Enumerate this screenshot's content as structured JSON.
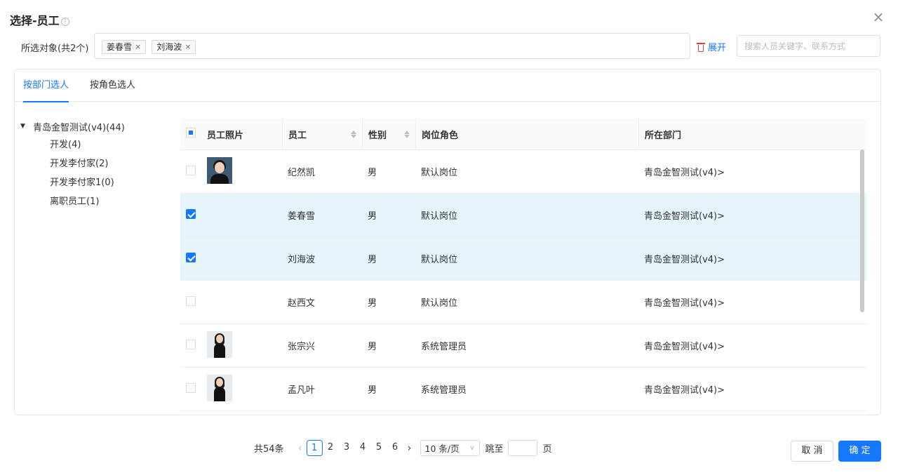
{
  "dialog": {
    "title": "选择-员工",
    "help_icon": "?",
    "close_icon": "×"
  },
  "selected": {
    "label": "所选对象(共2个)",
    "tags": [
      {
        "name": "姜春雪",
        "close": "×"
      },
      {
        "name": "刘海波",
        "close": "×"
      }
    ],
    "expand_label": "展开",
    "search_placeholder": "搜索人员关键字、联系方式"
  },
  "tabs": [
    {
      "label": "按部门选人",
      "active": true
    },
    {
      "label": "按角色选人",
      "active": false
    }
  ],
  "tree": {
    "root": {
      "label": "青岛金智测试(v4)(44)",
      "caret": "▼"
    },
    "children": [
      "开发(4)",
      "开发李付家(2)",
      "开发李付家1(0)",
      "离职员工(1)"
    ]
  },
  "table": {
    "headers": {
      "photo": "员工照片",
      "name": "员工",
      "gender": "性别",
      "role": "岗位角色",
      "dept": "所在部门"
    },
    "rows": [
      {
        "name": "纪然凯",
        "gender": "男",
        "role": "默认岗位",
        "dept": "青岛金智测试(v4)>",
        "checked": false,
        "photo": "dark"
      },
      {
        "name": "姜春雪",
        "gender": "男",
        "role": "默认岗位",
        "dept": "青岛金智测试(v4)>",
        "checked": true,
        "photo": ""
      },
      {
        "name": "刘海波",
        "gender": "男",
        "role": "默认岗位",
        "dept": "青岛金智测试(v4)>",
        "checked": true,
        "photo": ""
      },
      {
        "name": "赵西文",
        "gender": "男",
        "role": "默认岗位",
        "dept": "青岛金智测试(v4)>",
        "checked": false,
        "photo": ""
      },
      {
        "name": "张宗兴",
        "gender": "男",
        "role": "系统管理员",
        "dept": "青岛金智测试(v4)>",
        "checked": false,
        "photo": "light"
      },
      {
        "name": "孟凡叶",
        "gender": "男",
        "role": "系统管理员",
        "dept": "青岛金智测试(v4)>",
        "checked": false,
        "photo": "light"
      }
    ]
  },
  "pagination": {
    "total": "共54条",
    "prev": "‹",
    "next": "›",
    "pages": [
      "1",
      "2",
      "3",
      "4",
      "5",
      "6"
    ],
    "current": "1",
    "page_size": "10 条/页",
    "size_chevron": "∨",
    "jump_label": "跳至",
    "jump_suffix": "页"
  },
  "footer": {
    "cancel_label": "取 消",
    "ok_label": "确 定"
  },
  "colors": {
    "accent": "#1677ff",
    "selected_row": "#e6f4fb",
    "danger": "#e53935"
  }
}
